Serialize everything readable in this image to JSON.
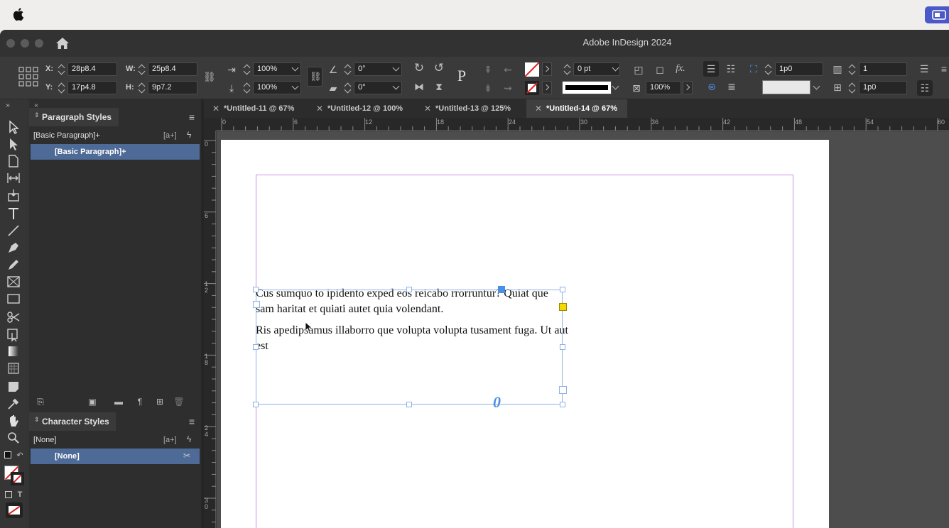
{
  "app": {
    "title": "Adobe InDesign 2024"
  },
  "colors": {
    "selection": "#4e6a96",
    "frame": "#8db2e6",
    "margin_guide": "#c991e3",
    "anchor": "#4a8fe6",
    "overflow": "#f5d800"
  },
  "control_panel": {
    "x_label": "X:",
    "x_value": "28p8.4",
    "y_label": "Y:",
    "y_value": "17p4.8",
    "w_label": "W:",
    "w_value": "25p8.4",
    "h_label": "H:",
    "h_value": "9p7.2",
    "scale_x": "100%",
    "scale_y": "100%",
    "rotate": "0°",
    "shear": "0°",
    "stroke_weight": "0 pt",
    "opacity": "100%",
    "column_gutter": "1p0",
    "columns": "1",
    "inset": "1p0",
    "para_symbol": "P"
  },
  "panels": {
    "paragraph_styles": {
      "title": "Paragraph Styles",
      "current": "[Basic Paragraph]+",
      "items": [
        "[Basic Paragraph]+"
      ],
      "new_from_sel": "[a+]"
    },
    "character_styles": {
      "title": "Character Styles",
      "current": "[None]",
      "items": [
        "[None]"
      ],
      "new_from_sel": "[a+]"
    }
  },
  "tabs": [
    {
      "label": "*Untitled-11 @ 67%"
    },
    {
      "label": "*Untitled-12 @ 100%"
    },
    {
      "label": "*Untitled-13 @ 125%"
    },
    {
      "label": "*Untitled-14 @ 67%"
    }
  ],
  "ruler": {
    "h_ticks": [
      "0",
      "6",
      "12",
      "18",
      "24",
      "30",
      "36",
      "42",
      "48",
      "54",
      "60"
    ],
    "v_ticks": [
      "0",
      "6",
      "12",
      "18",
      "24",
      "30"
    ]
  },
  "document": {
    "paragraphs": [
      "Cus sumquo to ipidento exped eos reicabo rrorruntur? Quiat que sam haritat et quiati autet quia volendant.",
      "Ris apedipsamus illaborro que volupta volupta tusament fuga. Ut aut est"
    ]
  }
}
